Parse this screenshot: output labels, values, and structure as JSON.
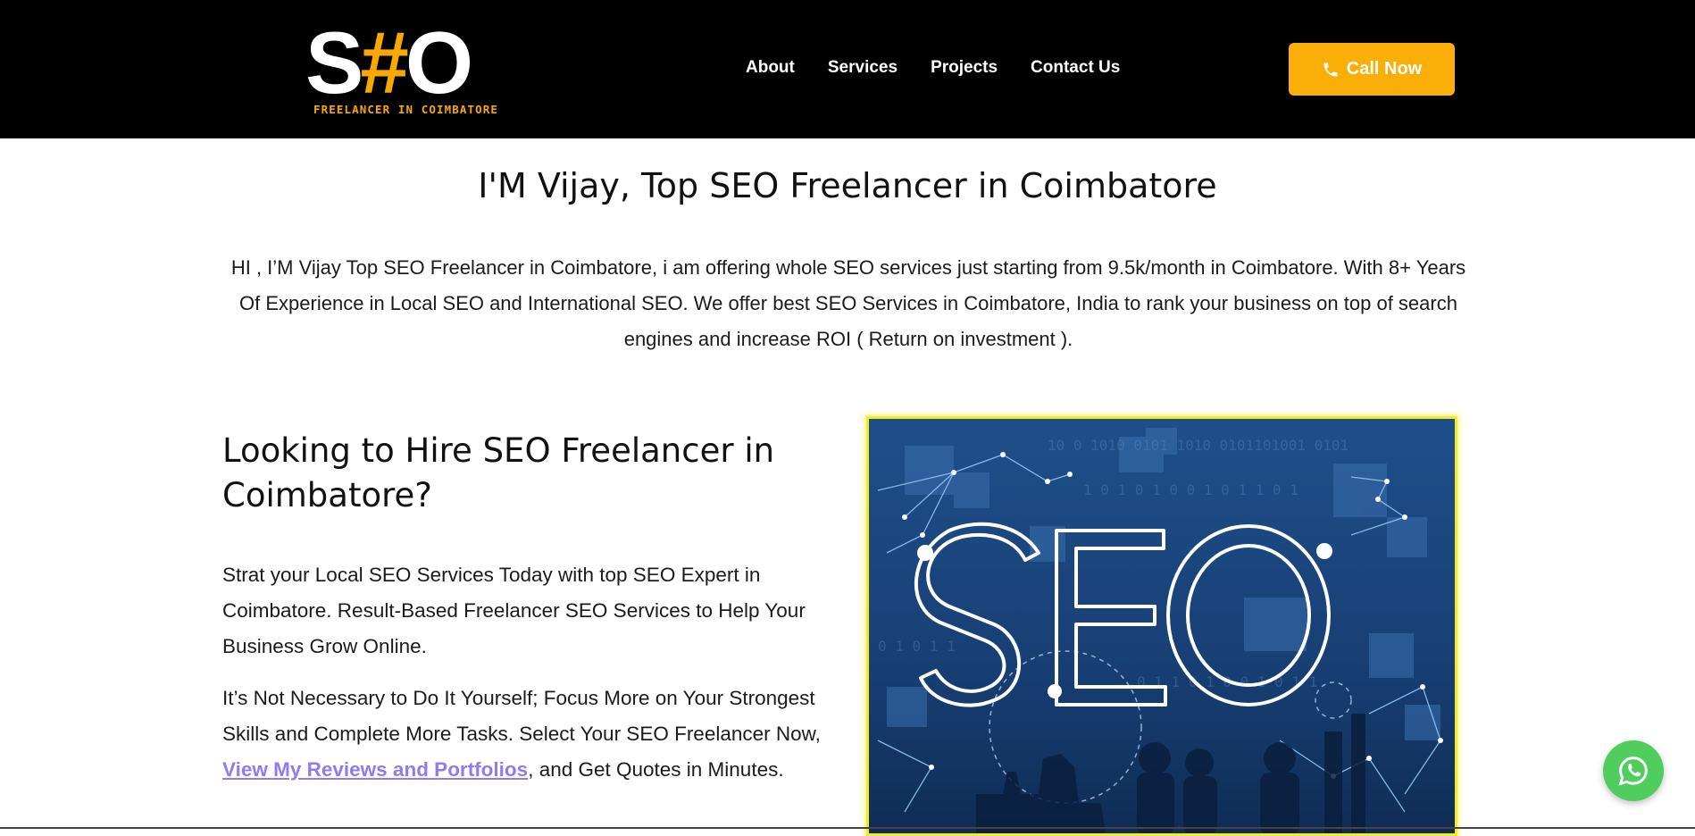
{
  "header": {
    "logo": {
      "main_left": "S",
      "main_hash": "#",
      "main_right": "O",
      "tagline": "FREELANCER IN COIMBATORE"
    },
    "nav": [
      {
        "label": "About"
      },
      {
        "label": "Services"
      },
      {
        "label": "Projects"
      },
      {
        "label": "Contact Us"
      }
    ],
    "cta": {
      "label": "Call Now",
      "icon": "phone-icon",
      "color": "#f9ae08"
    }
  },
  "hero": {
    "title": "I'M Vijay, Top SEO Freelancer in Coimbatore",
    "text": "HI , I’M Vijay Top SEO Freelancer in Coimbatore, i am offering whole SEO services just starting from 9.5k/month in Coimbatore. With 8+ Years Of Experience in Local SEO and International SEO. We offer best SEO Services in Coimbatore, India to rank your business on top of search engines and increase ROI ( Return on investment )."
  },
  "section": {
    "title": "Looking to Hire SEO Freelancer in Coimbatore?",
    "para1": "Strat your Local SEO Services Today with top SEO Expert in Coimbatore. Result-Based Freelancer SEO Services to Help Your Business Grow Online.",
    "para2_before": "It’s Not Necessary to Do It Yourself; Focus More on Your Strongest Skills and Complete More Tasks. Select Your SEO Freelancer Now, ",
    "para2_link": "View My Reviews and Portfolios",
    "para2_after": ", and Get Quotes in Minutes.",
    "image": {
      "text": "SEO",
      "border_color": "#f3ea2a"
    }
  },
  "floating": {
    "whatsapp_icon": "whatsapp-icon",
    "color": "#4fce5d"
  }
}
